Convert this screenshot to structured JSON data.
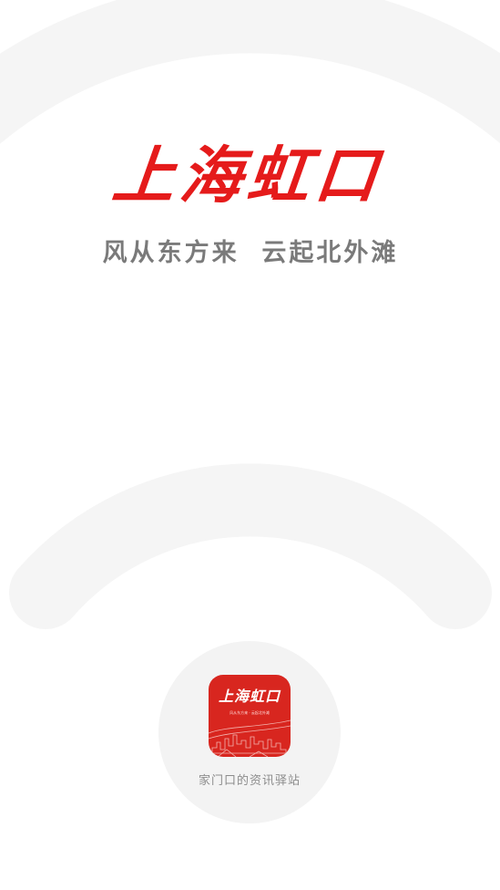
{
  "splash": {
    "logo_title": "上海虹口",
    "slogan": "风从东方来  云起北外滩",
    "tagline": "家门口的资讯驿站"
  },
  "app_icon": {
    "title": "上海虹口",
    "subtitle": "风从东方来 · 云起北外滩"
  },
  "colors": {
    "brand_red": "#e51b1b",
    "icon_red": "#d8261f",
    "slogan_gray": "#7a7a7a",
    "arc_gray": "#f5f5f5"
  },
  "icons": {
    "background": "wifi-arcs-icon",
    "app": "app-logo-icon"
  }
}
